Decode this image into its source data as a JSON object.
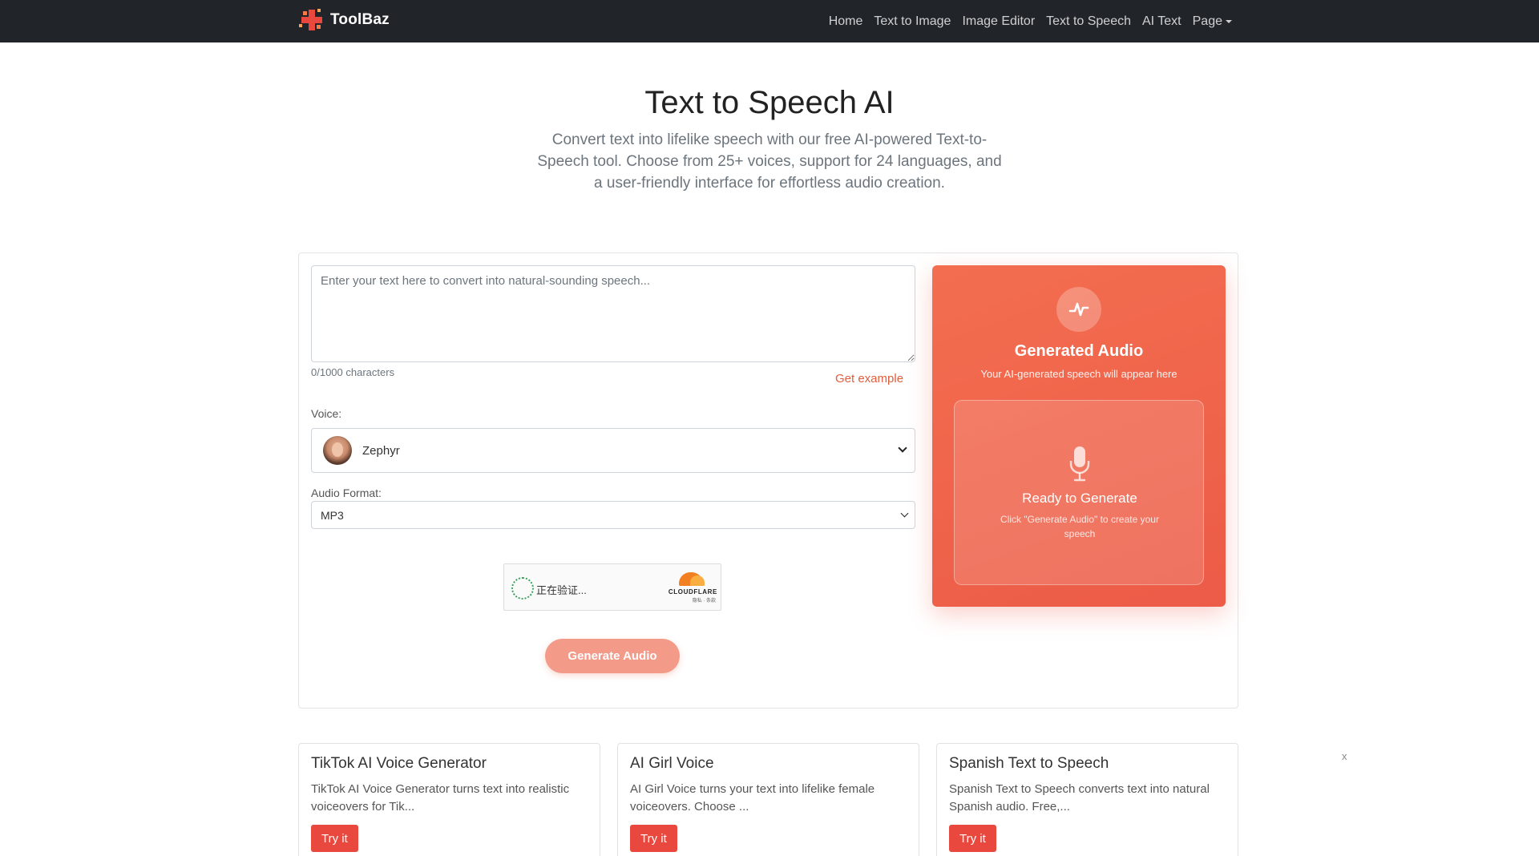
{
  "brand": {
    "name": "ToolBaz"
  },
  "nav": {
    "links": [
      "Home",
      "Text to Image",
      "Image Editor",
      "Text to Speech",
      "AI Text",
      "Page"
    ]
  },
  "hero": {
    "title": "Text to Speech AI",
    "description": "Convert text into lifelike speech with our free AI-powered Text-to-Speech tool. Choose from 25+ voices, support for 24 languages, and a user-friendly interface for effortless audio creation."
  },
  "form": {
    "text_placeholder": "Enter your text here to convert into natural-sounding speech...",
    "char_count": "0/1000 characters",
    "get_example": "Get example",
    "voice_label": "Voice:",
    "voice_value": "Zephyr",
    "format_label": "Audio Format:",
    "format_value": "MP3",
    "generate_label": "Generate Audio"
  },
  "captcha": {
    "status": "正在验证...",
    "provider": "CLOUDFLARE",
    "links": "隐私 · 条款"
  },
  "audio_panel": {
    "title": "Generated Audio",
    "subtitle": "Your AI-generated speech will appear here",
    "ready_title": "Ready to Generate",
    "ready_subtitle": "Click \"Generate Audio\" to create your speech"
  },
  "tools": [
    {
      "title": "TikTok AI Voice Generator",
      "description": "TikTok AI Voice Generator turns text into realistic voiceovers for Tik...",
      "button": "Try it"
    },
    {
      "title": "AI Girl Voice",
      "description": "AI Girl Voice turns your text into lifelike female voiceovers. Choose ...",
      "button": "Try it"
    },
    {
      "title": "Spanish Text to Speech",
      "description": "Spanish Text to Speech converts text into natural Spanish audio. Free,...",
      "button": "Try it"
    }
  ],
  "close_label": "x",
  "colors": {
    "navbar": "#212529",
    "accent": "#ec5b47",
    "try_button": "#e9483f",
    "link": "#e35d3a"
  }
}
